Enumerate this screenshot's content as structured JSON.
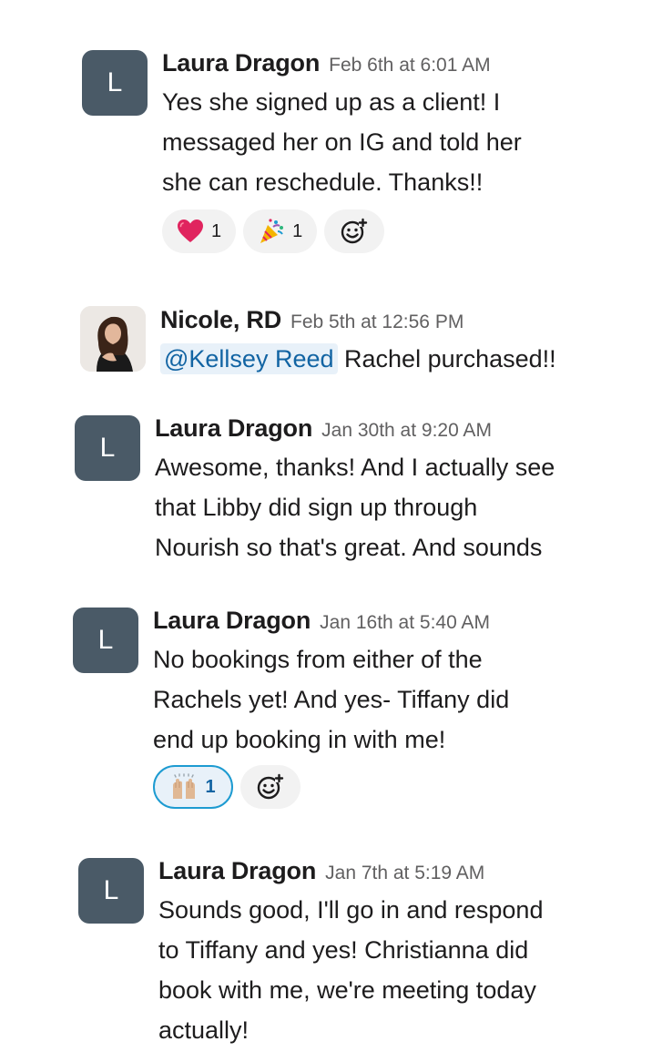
{
  "messages": [
    {
      "author": "Laura Dragon",
      "avatar_letter": "L",
      "time": "Feb 6th at 6:01 AM",
      "text": "Yes she signed up as a client! I\nmessaged her on IG and told her\nshe can reschedule. Thanks!!",
      "reactions": [
        {
          "icon": "red-heart-icon",
          "count": "1"
        },
        {
          "icon": "party-popper-icon",
          "count": "1"
        }
      ]
    },
    {
      "author": "Nicole, RD",
      "avatar": "profile-photo",
      "time": "Feb 5th at 12:56 PM",
      "mention": "@Kellsey Reed",
      "text": "Rachel purchased!!"
    },
    {
      "author": "Laura Dragon",
      "avatar_letter": "L",
      "time": "Jan 30th at 9:20 AM",
      "text": "Awesome, thanks! And I actually see\nthat Libby did sign up through\nNourish so that's great. And sounds"
    },
    {
      "author": "Laura Dragon",
      "avatar_letter": "L",
      "time": "Jan 16th at 5:40 AM",
      "text": "No bookings from either of the\nRachels yet! And yes- Tiffany did\nend up booking in with me!",
      "reactions": [
        {
          "icon": "raising-hands-icon",
          "count": "1",
          "active": true
        }
      ]
    },
    {
      "author": "Laura Dragon",
      "avatar_letter": "L",
      "time": "Jan 7th at 5:19 AM",
      "text": "Sounds good, I'll go in and respond\nto Tiffany and yes! Christianna did\nbook with me, we're meeting today\nactually!"
    }
  ],
  "colors": {
    "avatar_bg": "#4a5a67",
    "mention_bg": "#e8f1f9",
    "mention_text": "#1264a3",
    "active_reaction_border": "#1d9bd1",
    "heart": "#e0245e"
  }
}
